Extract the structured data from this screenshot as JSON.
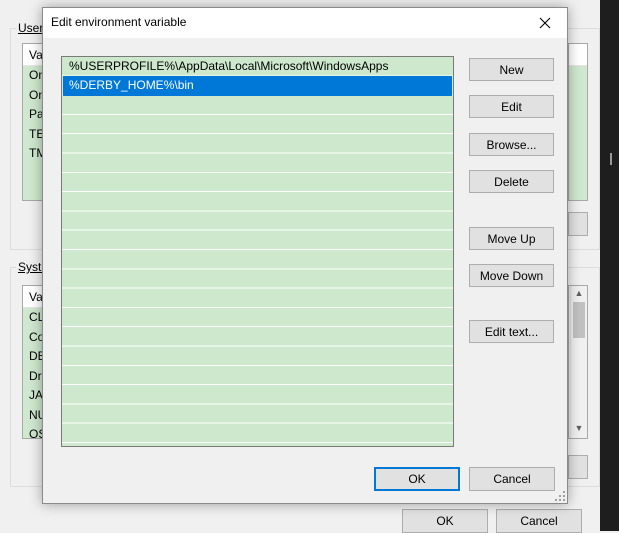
{
  "background_window": {
    "user_group_label": "User",
    "user_list_header": "Va",
    "user_rows": [
      "On",
      "On",
      "Pa",
      "TE",
      "TM"
    ],
    "system_group_label": "Syste",
    "system_list_header": "Va",
    "system_rows": [
      "CL",
      "Co",
      "DE",
      "Dr",
      "JA",
      "NU",
      "OS"
    ],
    "ok_label": "OK",
    "cancel_label": "Cancel",
    "scroll_up_icon": "chevron-up-icon",
    "scroll_down_icon": "chevron-down-icon"
  },
  "dialog": {
    "title": "Edit environment variable",
    "close_icon": "close-icon",
    "paths": [
      "%USERPROFILE%\\AppData\\Local\\Microsoft\\WindowsApps",
      "%DERBY_HOME%\\bin"
    ],
    "selected_index": 1,
    "buttons": {
      "new": "New",
      "edit": "Edit",
      "browse": "Browse...",
      "delete": "Delete",
      "move_up": "Move Up",
      "move_down": "Move Down",
      "edit_text": "Edit text..."
    },
    "ok_label": "OK",
    "cancel_label": "Cancel"
  },
  "colors": {
    "selection": "#0078d7",
    "list_background": "#cde8cd",
    "default_button_border": "#0078d7"
  }
}
